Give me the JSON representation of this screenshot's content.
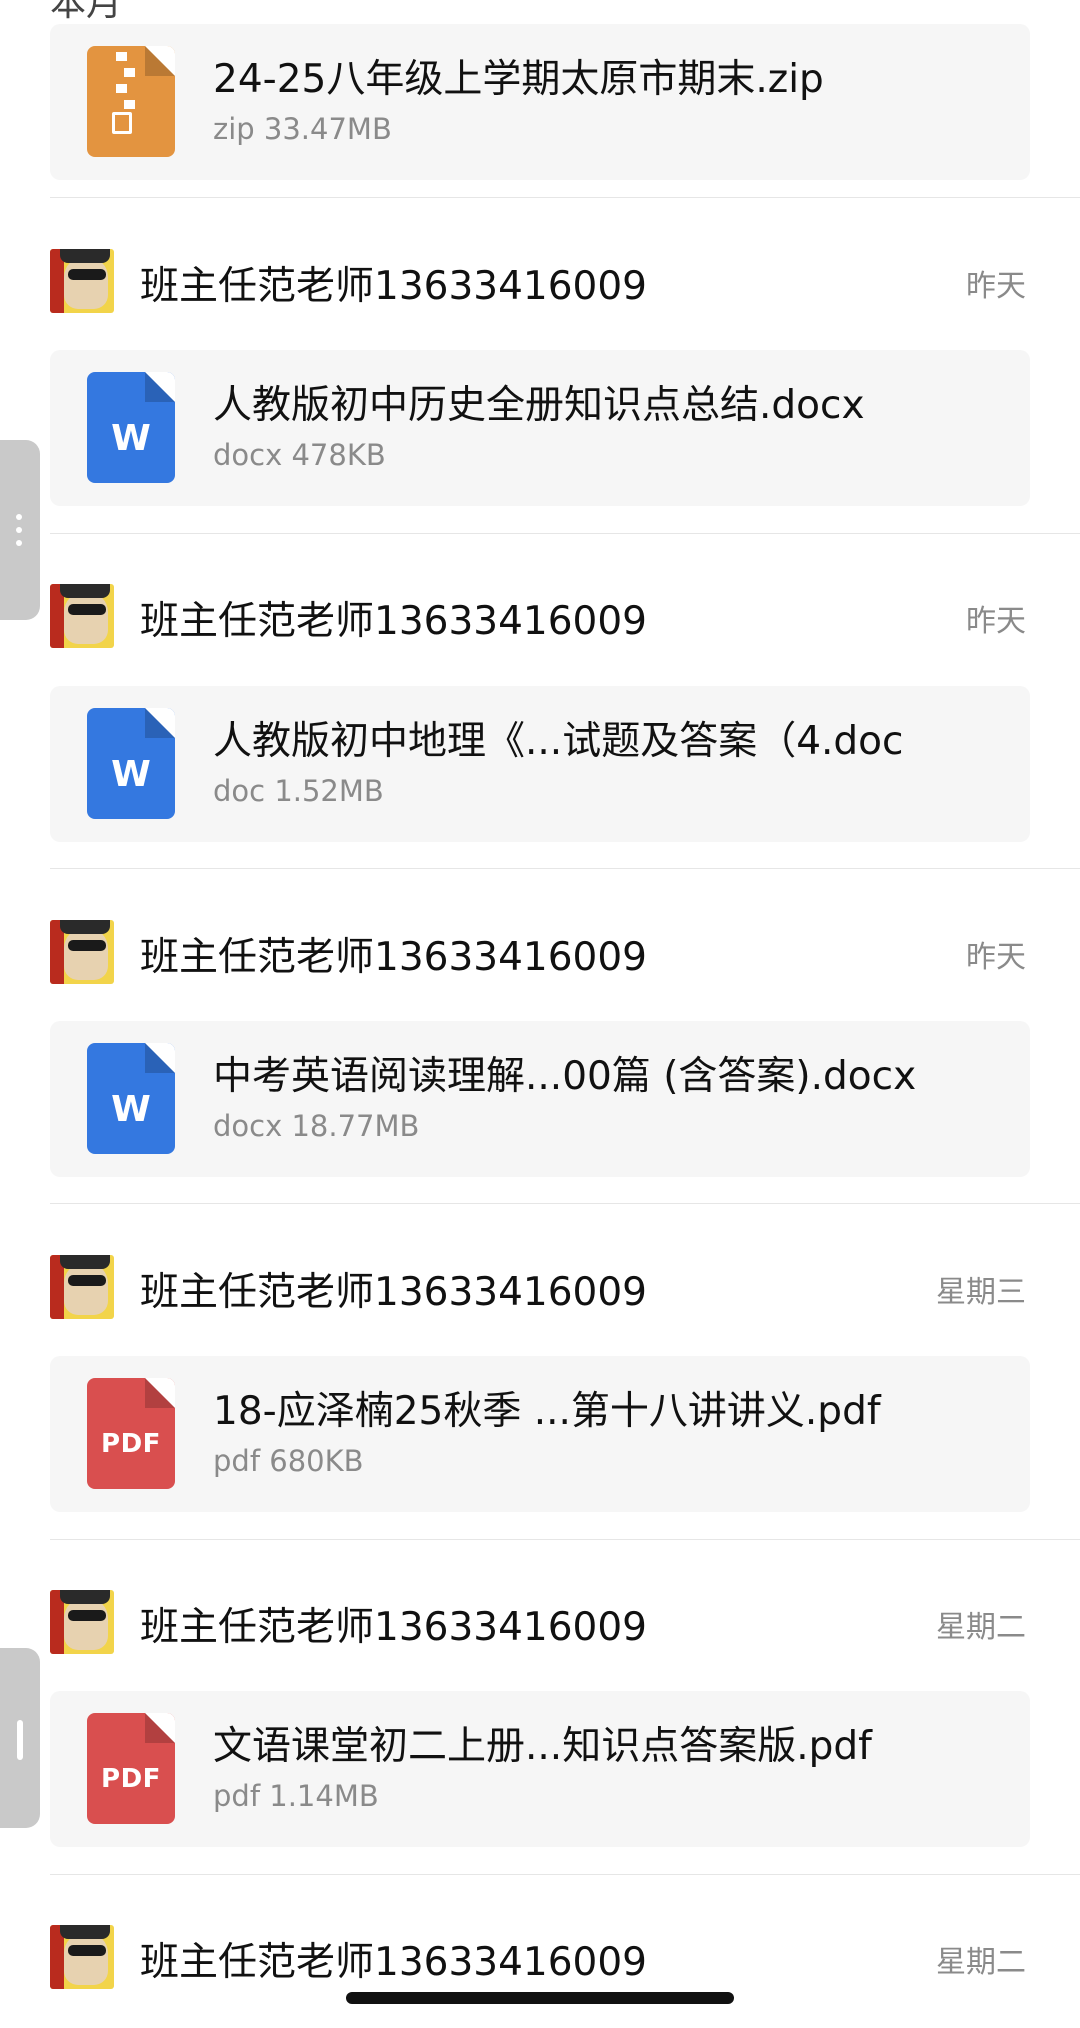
{
  "header_fragment": "本月",
  "messages": [
    {
      "sender": "",
      "time": "",
      "file": {
        "name": "24-25八年级上学期太原市期末.zip",
        "meta": "zip 33.47MB",
        "type": "zip",
        "icon": "zip-file-icon",
        "icon_color": "#e39440"
      }
    },
    {
      "sender": "班主任范老师13633416009",
      "time": "昨天",
      "file": {
        "name": "人教版初中历史全册知识点总结.docx",
        "meta": "docx 478KB",
        "type": "word",
        "icon_label": "W",
        "icon": "word-file-icon",
        "icon_color": "#3478e0"
      }
    },
    {
      "sender": "班主任范老师13633416009",
      "time": "昨天",
      "file": {
        "name": "人教版初中地理《...试题及答案（4.doc",
        "meta": "doc 1.52MB",
        "type": "word",
        "icon_label": "W",
        "icon": "word-file-icon",
        "icon_color": "#3478e0"
      }
    },
    {
      "sender": "班主任范老师13633416009",
      "time": "昨天",
      "file": {
        "name": "中考英语阅读理解...00篇 (含答案).docx",
        "meta": "docx 18.77MB",
        "type": "word",
        "icon_label": "W",
        "icon": "word-file-icon",
        "icon_color": "#3478e0"
      }
    },
    {
      "sender": "班主任范老师13633416009",
      "time": "星期三",
      "file": {
        "name": "18-应泽楠25秋季 ...第十八讲讲义.pdf",
        "meta": "pdf 680KB",
        "type": "pdf",
        "icon_label": "PDF",
        "icon": "pdf-file-icon",
        "icon_color": "#d94f4f"
      }
    },
    {
      "sender": "班主任范老师13633416009",
      "time": "星期二",
      "file": {
        "name": "文语课堂初二上册...知识点答案版.pdf",
        "meta": "pdf 1.14MB",
        "type": "pdf",
        "icon_label": "PDF",
        "icon": "pdf-file-icon",
        "icon_color": "#d94f4f"
      }
    },
    {
      "sender": "班主任范老师13633416009",
      "time": "星期二",
      "file": null
    }
  ]
}
